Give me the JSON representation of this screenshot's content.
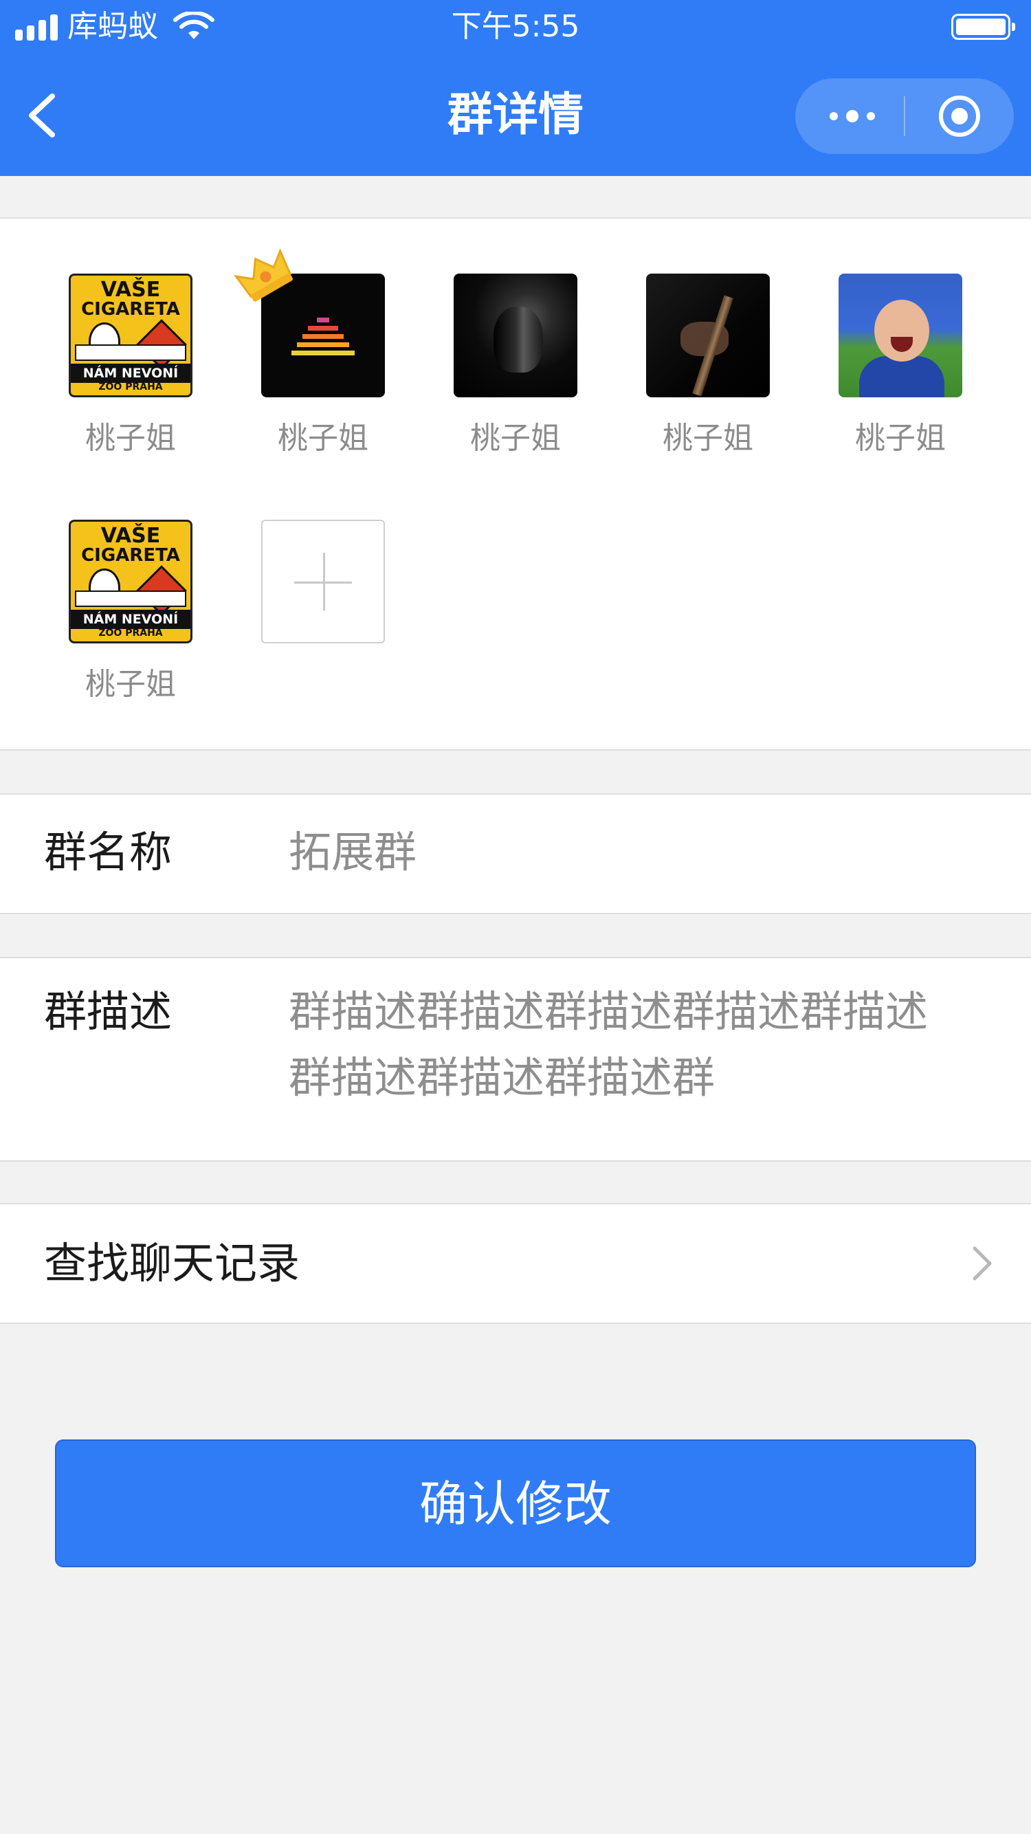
{
  "status_bar": {
    "carrier": "库蚂蚁",
    "time": "下午5:55",
    "battery_level": 1.0
  },
  "nav": {
    "title": "群详情",
    "back_icon": "chevron-left-icon",
    "more_icon": "more-dots-icon",
    "close_icon": "target-circle-icon"
  },
  "members": [
    {
      "name": "桃子姐",
      "avatar": "vase-cigareta-poster",
      "owner": false
    },
    {
      "name": "桃子姐",
      "avatar": "black-rainbow-stripes",
      "owner": true
    },
    {
      "name": "桃子姐",
      "avatar": "dark-portrait",
      "owner": false
    },
    {
      "name": "桃子姐",
      "avatar": "guitar-dark",
      "owner": false
    },
    {
      "name": "桃子姐",
      "avatar": "laughing-baby",
      "owner": false
    },
    {
      "name": "桃子姐",
      "avatar": "vase-cigareta-poster",
      "owner": false
    }
  ],
  "poster_text": {
    "line1": "VAŠE",
    "line2": "CIGARETA",
    "line3": "NÁM NEVONÍ",
    "line4": "ZOO PRAHA"
  },
  "group_name": {
    "label": "群名称",
    "value": "拓展群"
  },
  "group_desc": {
    "label": "群描述",
    "value_line1": "群描述群描述群描述群描述群描述",
    "value_line2": "群描述群描述群描述群"
  },
  "search_history": {
    "label": "查找聊天记录"
  },
  "confirm_button": {
    "label": "确认修改"
  },
  "colors": {
    "brand_blue": "#2f7cf6",
    "page_bg": "#f2f2f2"
  }
}
